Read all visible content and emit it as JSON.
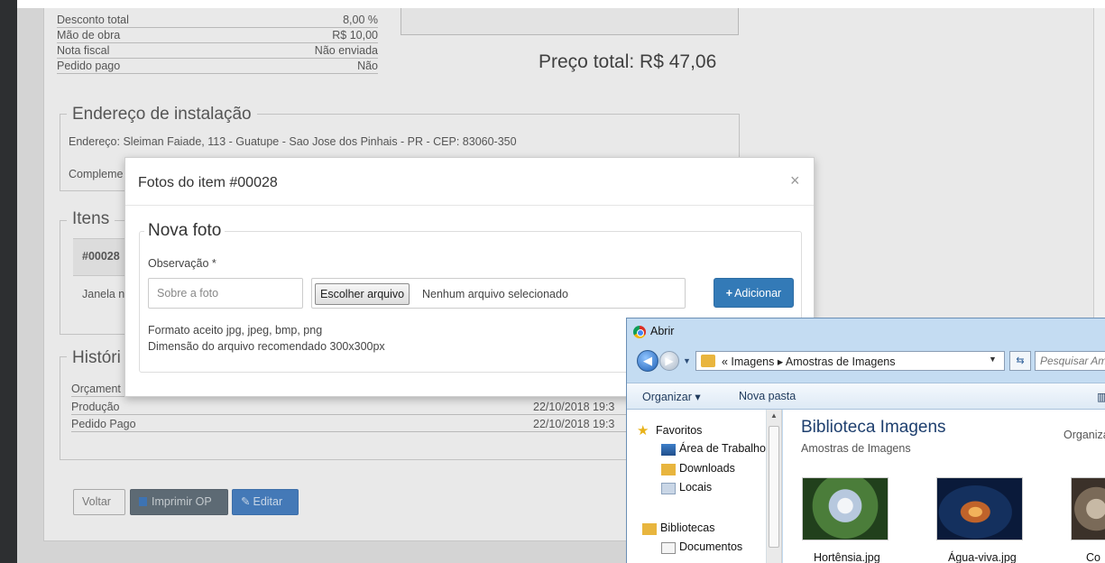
{
  "summary": {
    "rows": [
      {
        "label": "Desconto total",
        "value": "8,00 %"
      },
      {
        "label": "Mão de obra",
        "value": "R$ 10,00"
      },
      {
        "label": "Nota fiscal",
        "value": "Não enviada"
      },
      {
        "label": "Pedido pago",
        "value": "Não"
      }
    ],
    "total": "Preço total: R$ 47,06"
  },
  "address": {
    "legend": "Endereço de instalação",
    "line": "Endereço: Sleiman Faiade, 113 - Guatupe - Sao Jose dos Pinhais - PR - CEP: 83060-350",
    "complement_partial": "Compleme"
  },
  "items": {
    "legend": "Itens",
    "code_partial": "#00028",
    "row_partial": "Janela n"
  },
  "history": {
    "legend_partial": "Históri",
    "rows": [
      {
        "label": "Orçament",
        "date": ""
      },
      {
        "label": "Produção",
        "date": "22/10/2018 19:3"
      },
      {
        "label": "Pedido Pago",
        "date": "22/10/2018 19:3"
      }
    ]
  },
  "actions": {
    "back": "Voltar",
    "print": "Imprimir OP",
    "edit": "Editar"
  },
  "modal": {
    "title": "Fotos do item #00028",
    "close": "×",
    "legend": "Nova foto",
    "obs_label": "Observação *",
    "obs_placeholder": "Sobre a foto",
    "file_button": "Escolher arquivo",
    "file_status": "Nenhum arquivo selecionado",
    "add_button": "Adicionar",
    "help_formats": "Formato aceito jpg, jpeg, bmp, png",
    "help_size": "Dimensão do arquivo recomendado 300x300px"
  },
  "file_dialog": {
    "title": "Abrir",
    "address": "«  Imagens  ▸  Amostras de Imagens",
    "search_placeholder": "Pesquisar Amo",
    "commands": {
      "organize": "Organizar ▾",
      "new_folder": "Nova pasta"
    },
    "nav": {
      "favorites": "Favoritos",
      "desktop": "Área de Trabalho",
      "downloads": "Downloads",
      "places": "Locais",
      "libraries": "Bibliotecas",
      "documents": "Documentos"
    },
    "library_title": "Biblioteca Imagens",
    "library_subtitle": "Amostras de Imagens",
    "arrange_partial": "Organizar",
    "files": [
      {
        "name": "Hortênsia.jpg"
      },
      {
        "name": "Água-viva.jpg"
      },
      {
        "name": "Co"
      }
    ]
  }
}
